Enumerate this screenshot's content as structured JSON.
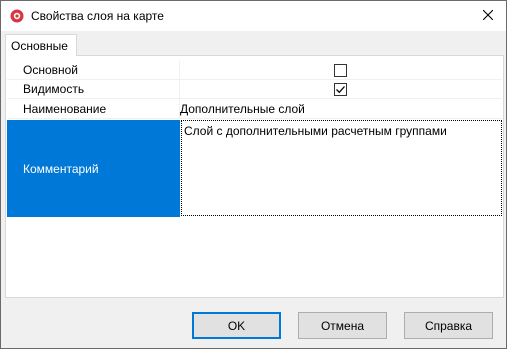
{
  "window": {
    "title": "Свойства слоя на карте",
    "icon": "layer-properties-icon",
    "close_icon": "close-icon"
  },
  "tabs": [
    {
      "label": "Основные",
      "active": true
    }
  ],
  "properties": [
    {
      "name": "Основной",
      "type": "checkbox",
      "checked": false
    },
    {
      "name": "Видимость",
      "type": "checkbox",
      "checked": true
    },
    {
      "name": "Наименование",
      "type": "text",
      "value": "Дополнительные слой"
    },
    {
      "name": "Комментарий",
      "type": "multiline",
      "value": "Слой с дополнительными расчетным группами",
      "selected": true
    }
  ],
  "buttons": {
    "ok": "OK",
    "cancel": "Отмена",
    "help": "Справка"
  },
  "colors": {
    "selection": "#0078d7",
    "window_bg": "#f0f0f0",
    "app_icon": "#d9363e"
  }
}
